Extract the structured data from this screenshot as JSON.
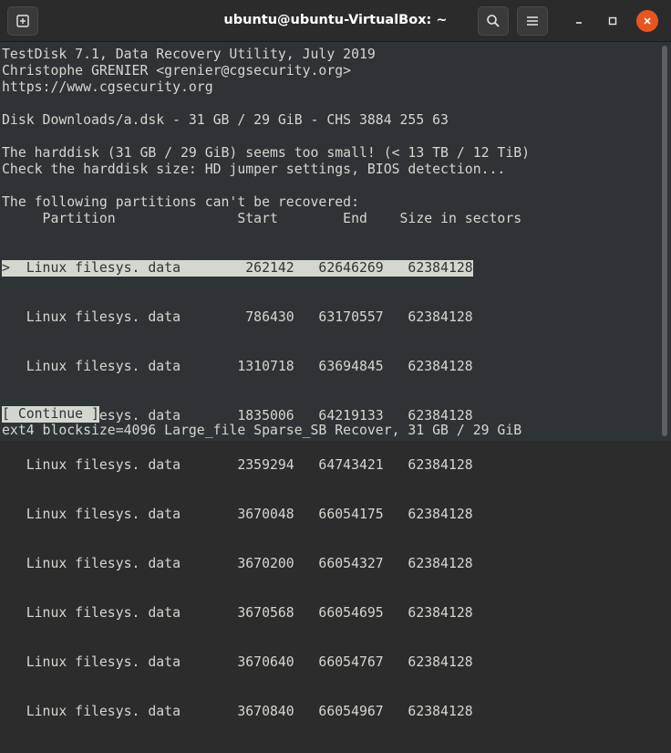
{
  "window": {
    "title": "ubuntu@ubuntu-VirtualBox: ~",
    "icons": [
      "new-tab-icon",
      "search-icon",
      "hamburger-menu-icon",
      "minimize-icon",
      "maximize-icon",
      "close-icon"
    ],
    "accent_color": "#e95420"
  },
  "terminal": {
    "header": [
      "TestDisk 7.1, Data Recovery Utility, July 2019",
      "Christophe GRENIER <grenier@cgsecurity.org>",
      "https://www.cgsecurity.org"
    ],
    "disk_info": "Disk Downloads/a.dsk - 31 GB / 29 GiB - CHS 3884 255 63",
    "warning_1": "The harddisk (31 GB / 29 GiB) seems too small! (< 13 TB / 12 TiB)",
    "warning_2": "Check the harddisk size: HD jumper settings, BIOS detection...",
    "partitions_heading": "The following partitions can't be recovered:",
    "table": {
      "header": "     Partition               Start        End    Size in sectors",
      "rows": [
        ">  Linux filesys. data        262142   62646269   62384128",
        "   Linux filesys. data        786430   63170557   62384128",
        "   Linux filesys. data       1310718   63694845   62384128",
        "   Linux filesys. data       1835006   64219133   62384128",
        "   Linux filesys. data       2359294   64743421   62384128",
        "   Linux filesys. data       3670048   66054175   62384128",
        "   Linux filesys. data       3670200   66054327   62384128",
        "   Linux filesys. data       3670568   66054695   62384128",
        "   Linux filesys. data       3670640   66054767   62384128",
        "   Linux filesys. data       3670840   66054967   62384128"
      ]
    },
    "continue_button": "[ Continue ]",
    "status_line": "ext4 blocksize=4096 Large_file Sparse_SB Recover, 31 GB / 29 GiB"
  }
}
